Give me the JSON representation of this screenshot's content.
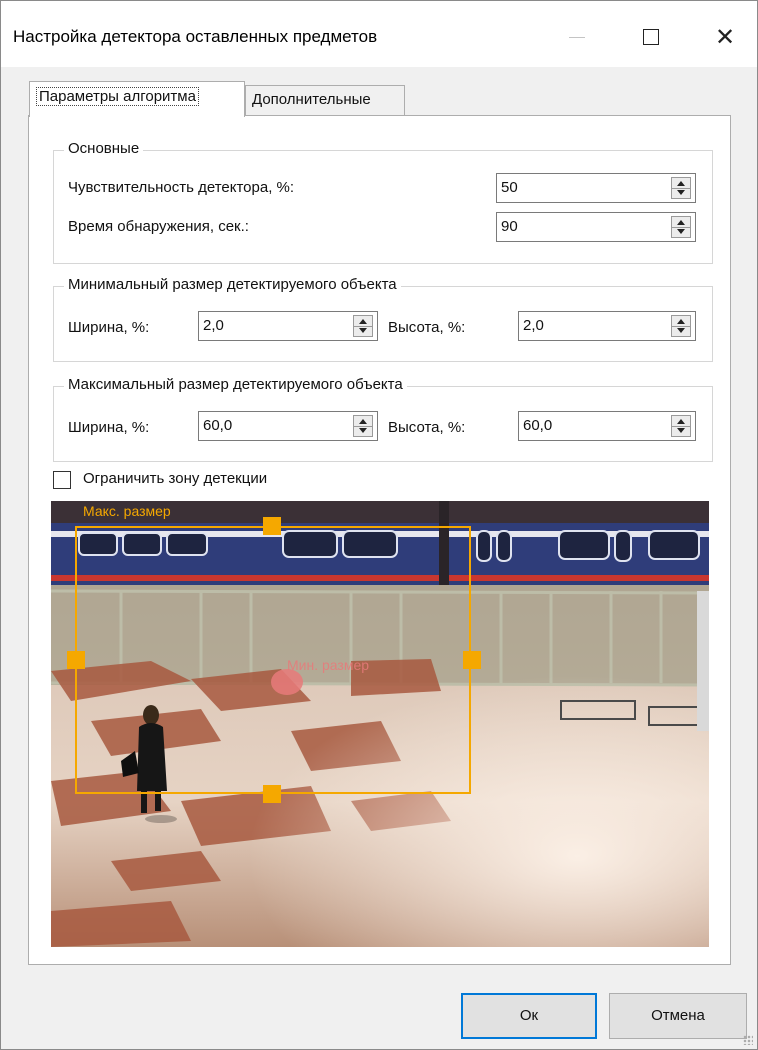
{
  "window": {
    "title": "Настройка детектора оставленных предметов",
    "min_glyph": "—",
    "close_glyph": "✕"
  },
  "tabs": [
    {
      "label": "Параметры алгоритма",
      "active": true
    },
    {
      "label": "Дополнительные",
      "active": false
    }
  ],
  "basic": {
    "title": "Основные",
    "sensitivity_label": "Чувствительность детектора, %:",
    "sensitivity_value": "50",
    "time_label": "Время обнаружения, сек.:",
    "time_value": "90"
  },
  "min_size": {
    "title": "Минимальный размер детектируемого объекта",
    "width_label": "Ширина, %:",
    "width_value": "2,0",
    "height_label": "Высота, %:",
    "height_value": "2,0"
  },
  "max_size": {
    "title": "Максимальный размер детектируемого объекта",
    "width_label": "Ширина, %:",
    "width_value": "60,0",
    "height_label": "Высота, %:",
    "height_value": "60,0"
  },
  "zone": {
    "checkbox_label": "Ограничить зону детекции",
    "checked": false
  },
  "preview": {
    "max_label": "Макс. размер",
    "min_label": "Мин. размер",
    "accent": "#f5a800",
    "min_color": "#e87a7a"
  },
  "buttons": {
    "ok": "Ок",
    "cancel": "Отмена"
  }
}
